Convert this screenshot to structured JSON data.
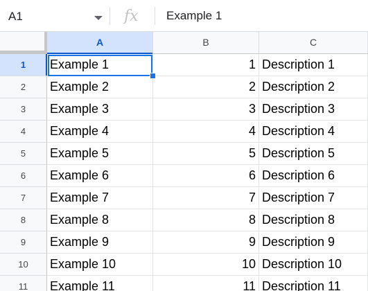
{
  "formula_bar": {
    "name_box": "A1",
    "fx_icon": "fx-icon",
    "value": "Example 1"
  },
  "columns": [
    {
      "label": "A"
    },
    {
      "label": "B"
    },
    {
      "label": "C"
    }
  ],
  "selected_cell": "A1",
  "rows": [
    {
      "num": "1",
      "a": "Example 1",
      "b": "1",
      "c": "Description 1"
    },
    {
      "num": "2",
      "a": "Example 2",
      "b": "2",
      "c": "Description 2"
    },
    {
      "num": "3",
      "a": "Example 3",
      "b": "3",
      "c": "Description 3"
    },
    {
      "num": "4",
      "a": "Example 4",
      "b": "4",
      "c": "Description 4"
    },
    {
      "num": "5",
      "a": "Example 5",
      "b": "5",
      "c": "Description 5"
    },
    {
      "num": "6",
      "a": "Example 6",
      "b": "6",
      "c": "Description 6"
    },
    {
      "num": "7",
      "a": "Example 7",
      "b": "7",
      "c": "Description 7"
    },
    {
      "num": "8",
      "a": "Example 8",
      "b": "8",
      "c": "Description 8"
    },
    {
      "num": "9",
      "a": "Example 9",
      "b": "9",
      "c": "Description 9"
    },
    {
      "num": "10",
      "a": "Example 10",
      "b": "10",
      "c": "Description 10"
    },
    {
      "num": "11",
      "a": "Example 11",
      "b": "11",
      "c": "Description 11"
    }
  ],
  "colors": {
    "selection": "#1a73e8",
    "header_selected_bg": "#d3e3fd",
    "header_selected_text": "#0b57d0"
  }
}
